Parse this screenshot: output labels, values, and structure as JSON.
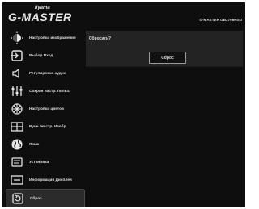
{
  "brand": {
    "sub": "iiyama",
    "main": "G-MASTER"
  },
  "model": "G-MASTER GB2766HSU",
  "menu": {
    "items": [
      {
        "label": "Настройка изображения",
        "icon": "brightness-icon"
      },
      {
        "label": "Выбор Вход",
        "icon": "input-icon"
      },
      {
        "label": "Регулировка аудио",
        "icon": "speaker-icon"
      },
      {
        "label": "Сохран настр. польз.",
        "icon": "sliders-icon"
      },
      {
        "label": "Настройка цветов",
        "icon": "color-icon"
      },
      {
        "label": "Ручн. Настр. Изобр.",
        "icon": "layout-icon"
      },
      {
        "label": "Язык",
        "icon": "globe-icon"
      },
      {
        "label": "Установка",
        "icon": "setup-icon"
      },
      {
        "label": "Информация Дисплея",
        "icon": "display-info-icon"
      },
      {
        "label": "Сброс",
        "icon": "reset-icon",
        "active": true
      }
    ]
  },
  "panel": {
    "question": "Сбросить?",
    "button_label": "Сброс"
  }
}
